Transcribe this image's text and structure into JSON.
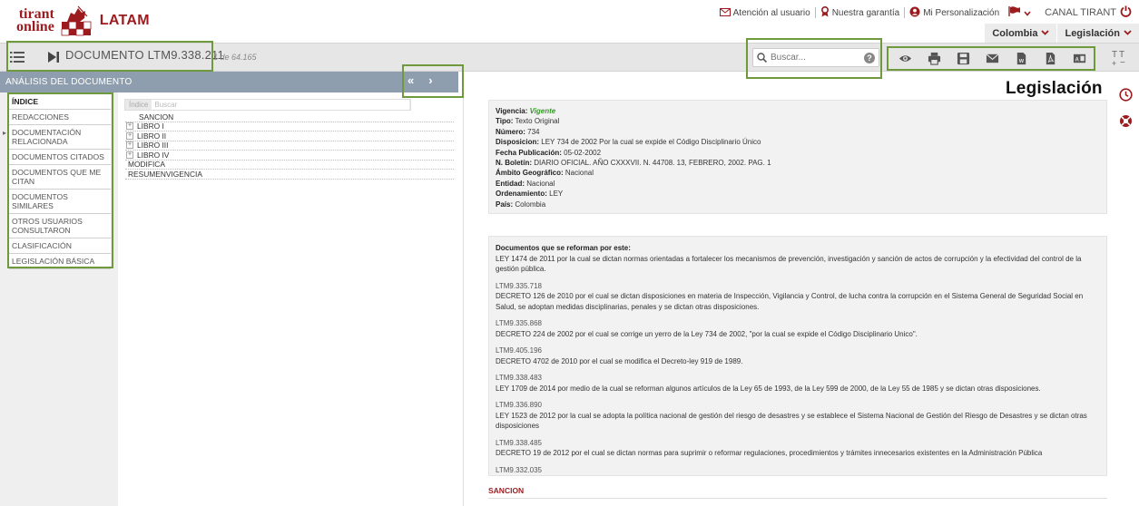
{
  "header": {
    "logo_top": "tirant",
    "logo_bottom": "online",
    "region": "LATAM",
    "links": {
      "atencion": "Atención al usuario",
      "garantia": "Nuestra garantía",
      "personalizacion": "Mi Personalización",
      "canal": "CANAL TIRANT"
    },
    "tabs": [
      "Colombia",
      "Legislación"
    ]
  },
  "toolbar": {
    "doc_label": "DOCUMENTO LTM9.338.211",
    "doc_count": "1 de 64.165",
    "search_placeholder": "Buscar...",
    "help": "?"
  },
  "panel": {
    "header": "ANÁLISIS DEL DOCUMENTO",
    "collapse_left": "«",
    "collapse_right": "›",
    "nav": [
      "ÍNDICE",
      "REDACCIONES",
      "DOCUMENTACIÓN RELACIONADA",
      "DOCUMENTOS CITADOS",
      "DOCUMENTOS QUE ME CITAN",
      "DOCUMENTOS SIMILARES",
      "OTROS USUARIOS CONSULTARON",
      "CLASIFICACIÓN",
      "LEGISLACIÓN BÁSICA"
    ],
    "index_label": "Índice",
    "index_search_placeholder": "Buscar",
    "tree": [
      "SANCION",
      "LIBRO I",
      "LIBRO II",
      "LIBRO III",
      "LIBRO IV",
      "MODIFICA",
      "RESUMENVIGENCIA"
    ]
  },
  "document": {
    "section_title": "Legislación",
    "meta": {
      "vigencia_label": "Vigencia:",
      "vigencia": "Vigente",
      "tipo_label": "Tipo:",
      "tipo": "Texto Original",
      "numero_label": "Número:",
      "numero": "734",
      "disposicion_label": "Disposicion:",
      "disposicion": "LEY 734 de 2002 Por la cual se expide el Código Disciplinario Único",
      "fecha_label": "Fecha Publicación:",
      "fecha": "05-02-2002",
      "boletin_label": "N. Boletín:",
      "boletin": "DIARIO OFICIAL. AÑO CXXXVII. N. 44708. 13, FEBRERO, 2002. PAG. 1",
      "ambito_label": "Ámbito Geográfico:",
      "ambito": "Nacional",
      "entidad_label": "Entidad:",
      "entidad": "Nacional",
      "ordenamiento_label": "Ordenamiento:",
      "ordenamiento": "LEY",
      "pais_label": "País:",
      "pais": "Colombia"
    },
    "refs_title": "Documentos que se reforman por este:",
    "refs_intro": "LEY 1474 de 2011 por la cual se dictan normas orientadas a fortalecer los mecanismos de prevención, investigación y sanción de actos de corrupción y la efectividad del control de la gestión pública.",
    "refs": [
      {
        "id": "LTM9.335.718",
        "text": "DECRETO 126 de 2010 por el cual se dictan disposiciones en materia de Inspección, Vigilancia y Control, de lucha contra la corrupción en el Sistema General de Seguridad Social en Salud, se adoptan medidas disciplinarias, penales y se dictan otras disposiciones."
      },
      {
        "id": "LTM9.335.868",
        "text": "DECRETO 224 de 2002 por el cual se corrige un yerro de la Ley 734 de 2002, \"por la cual se expide el Código Disciplinario Unico\"."
      },
      {
        "id": "LTM9.405.196",
        "text": "DECRETO 4702 de 2010 por el cual se modifica el Decreto-ley 919 de 1989."
      },
      {
        "id": "LTM9.338.483",
        "text": "LEY 1709 de 2014 por medio de la cual se reforman algunos artículos de la Ley 65 de 1993, de la Ley 599 de 2000, de la Ley 55 de 1985 y se dictan otras disposiciones."
      },
      {
        "id": "LTM9.336.890",
        "text": "LEY 1523 de 2012 por la cual se adopta la política nacional de gestión del riesgo de desastres y se establece el Sistema Nacional de Gestión del Riesgo de Desastres y se dictan otras disposiciones"
      },
      {
        "id": "LTM9.338.485",
        "text": "DECRETO 19 de 2012 por el cual se dictan normas para suprimir o reformar regulaciones, procedimientos y trámites innecesarios existentes en la Administración Pública"
      },
      {
        "id": "LTM9.332.035",
        "text": ""
      }
    ],
    "sancion_heading": "SANCION"
  },
  "colors": {
    "brand": "#9b1b1f",
    "panel_header": "#8e9eae",
    "highlight": "#6e9a3d",
    "vigente": "#3a9a2e"
  }
}
